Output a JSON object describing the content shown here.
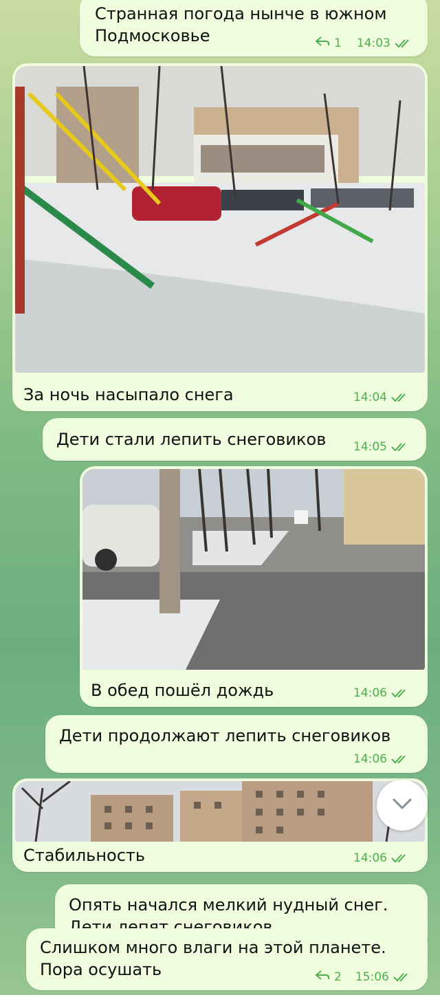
{
  "messages": [
    {
      "text": "Странная погода нынче в южном Подмосковье",
      "replies": "1",
      "time": "14:03"
    },
    {
      "caption": "За ночь насыпало снега",
      "time": "14:04"
    },
    {
      "text": "Дети стали лепить снеговиков",
      "time": "14:05"
    },
    {
      "caption": "В обед пошёл дождь",
      "time": "14:06"
    },
    {
      "text": "Дети продолжают лепить снеговиков",
      "time": "14:06"
    },
    {
      "caption": "Стабильность",
      "time": "14:06"
    },
    {
      "text": "Опять начался мелкий нудный снег. Дети лепят снеговиков"
    },
    {
      "text": "Слишком много влаги на этой планете. Пора осушать",
      "replies": "2",
      "time": "15:06"
    }
  ],
  "icons": {
    "reply": "reply-arrow-icon",
    "read": "double-check-icon",
    "scroll": "chevron-down-icon"
  },
  "colors": {
    "bubble": "#effdde",
    "meta": "#4fae4e",
    "background": "#8fc58a"
  }
}
